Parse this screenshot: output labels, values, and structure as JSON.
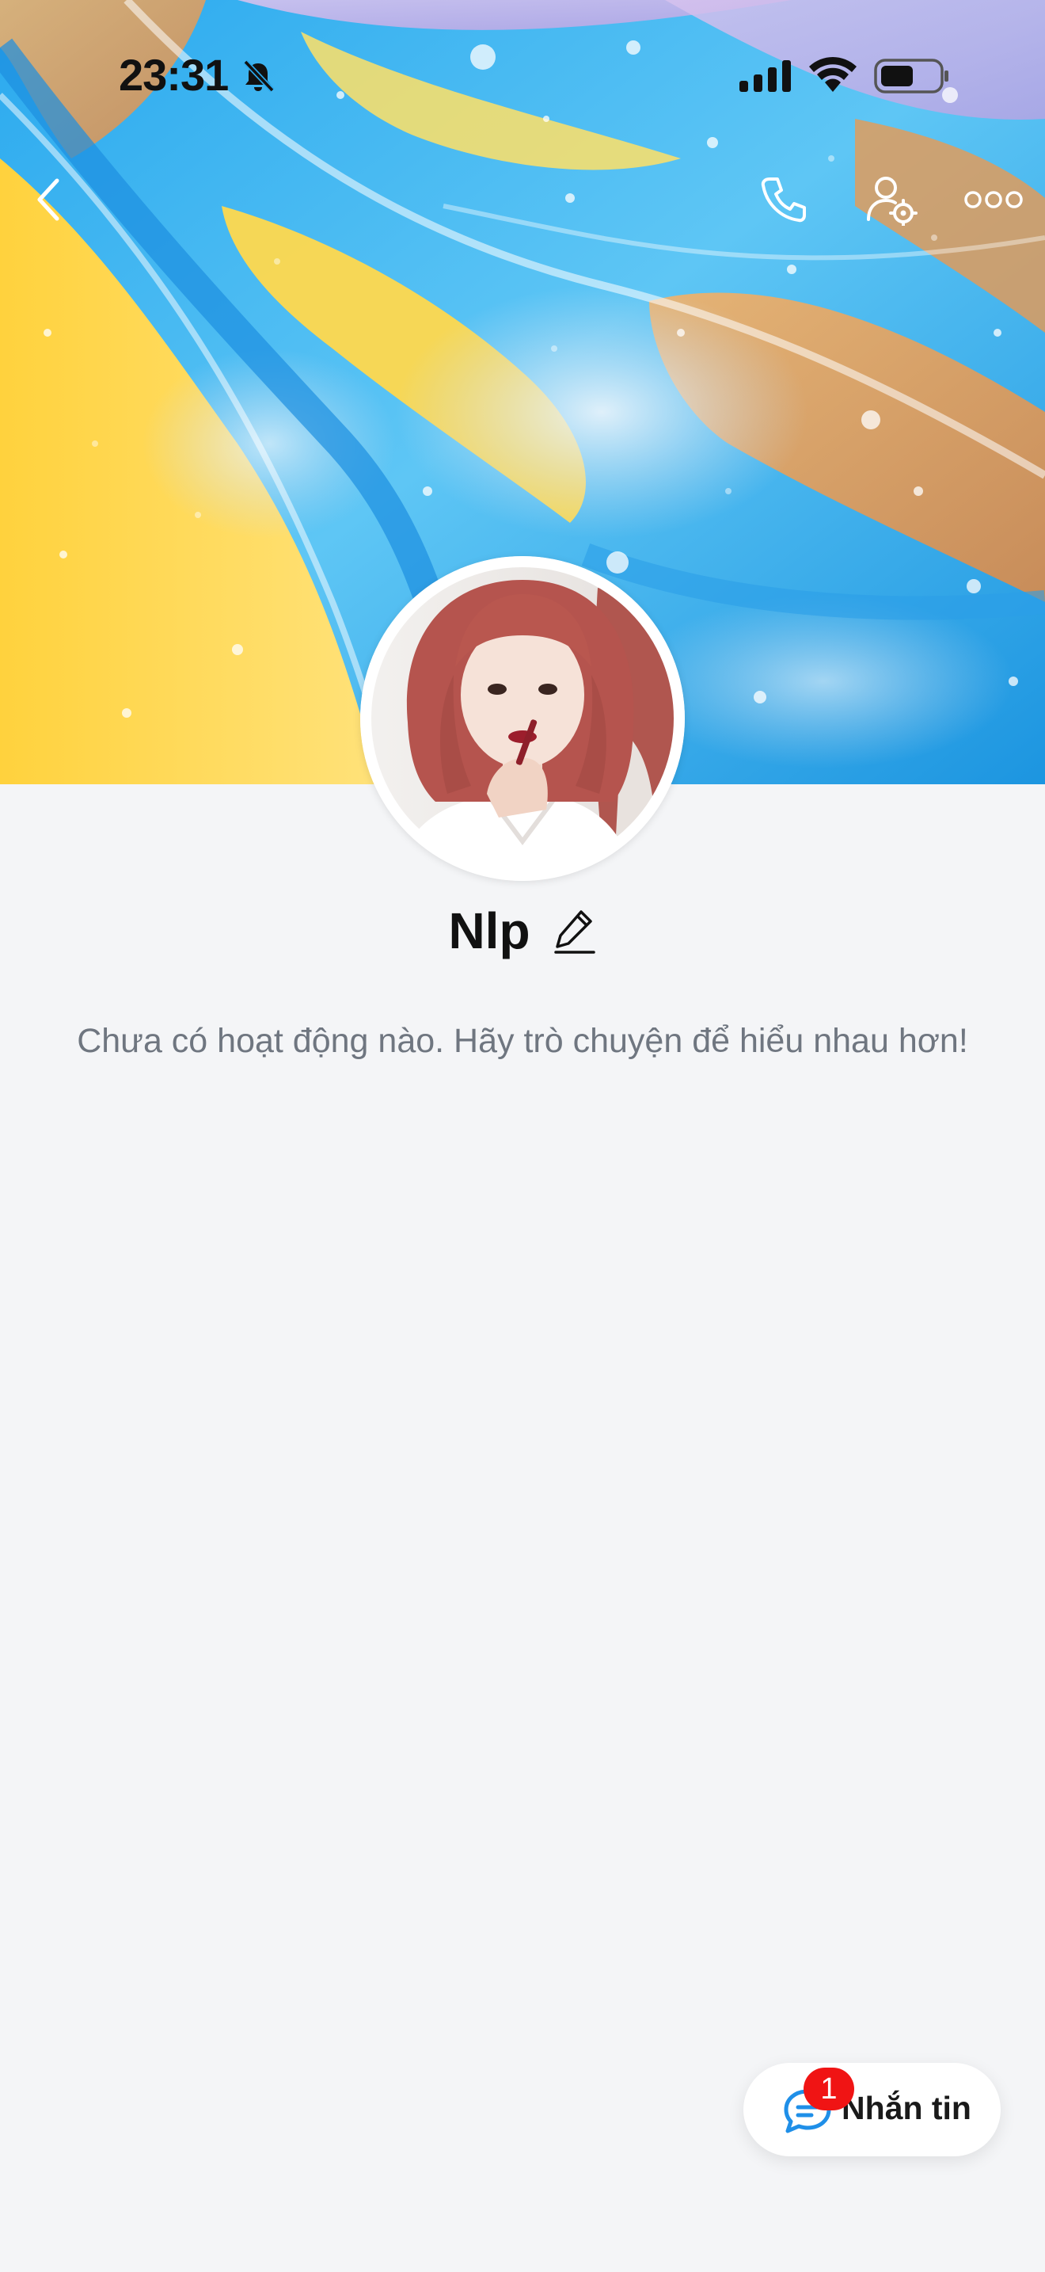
{
  "status_bar": {
    "time": "23:31"
  },
  "icons": {
    "mute": "bell-slash-icon",
    "signal": "cellular-signal-icon",
    "wifi": "wifi-icon",
    "battery": "battery-icon",
    "back": "chevron-left-icon",
    "call": "phone-icon",
    "profile_settings": "user-gear-icon",
    "more": "more-horizontal-icon",
    "edit": "pencil-icon",
    "chat": "chat-bubble-icon"
  },
  "profile": {
    "name": "Nlp"
  },
  "activity": {
    "empty_message": "Chưa có hoạt động nào. Hãy trò chuyện để hiểu nhau hơn!"
  },
  "message_button": {
    "label": "Nhắn tin",
    "badge_count": "1"
  },
  "colors": {
    "background": "#f4f5f7",
    "accent_blue": "#1f8fe8",
    "badge_red": "#f01414"
  }
}
